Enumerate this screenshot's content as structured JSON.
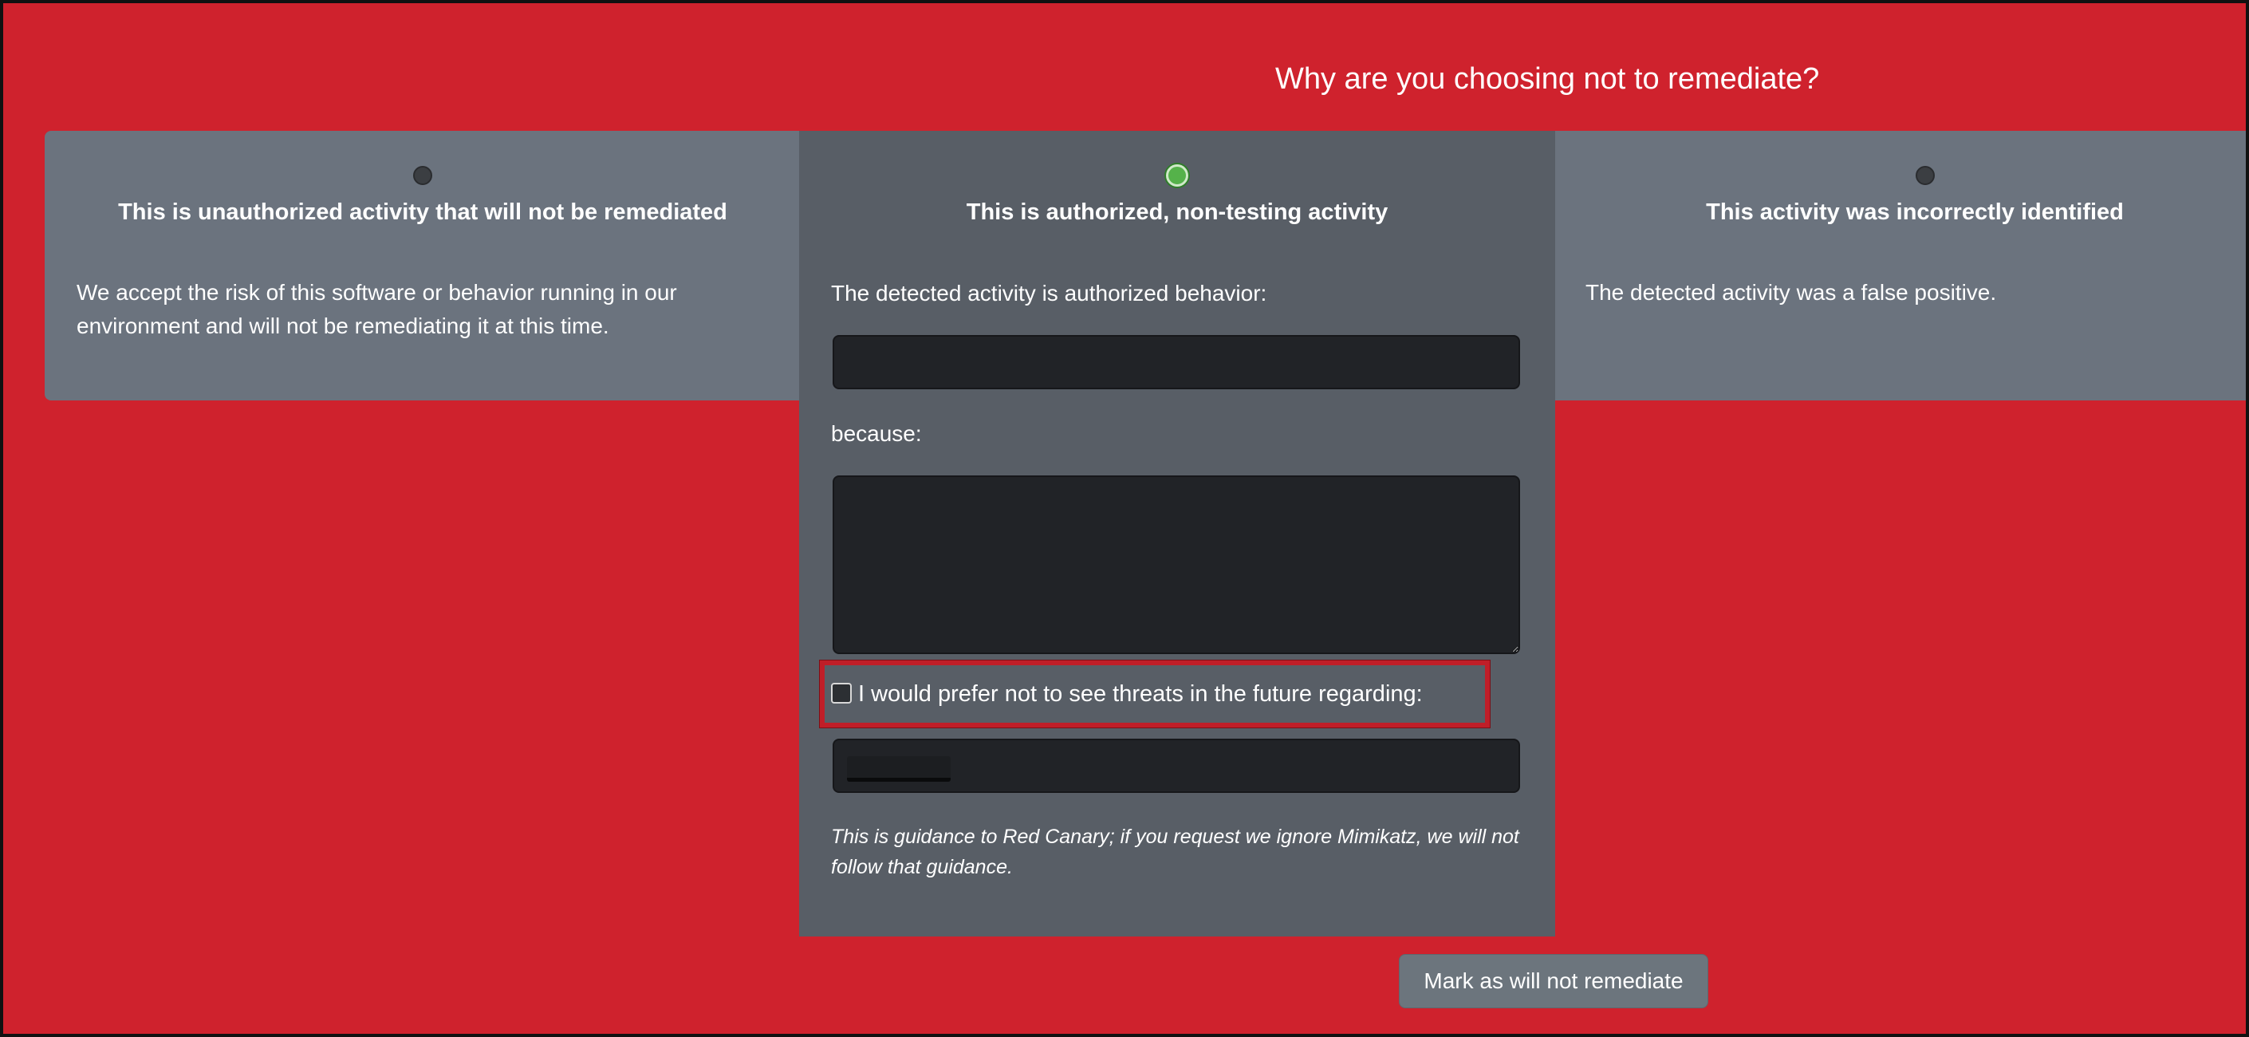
{
  "page": {
    "title": "Why are you choosing not to remediate?"
  },
  "options": [
    {
      "title": "This is unauthorized activity that will not be remediated",
      "description": "We accept the risk of this software or behavior running in our environment and will not be remediating it at this time.",
      "selected": false
    },
    {
      "title": "This is authorized, non-testing activity",
      "selected": true,
      "behavior_label": "The detected activity is authorized behavior:",
      "behavior_value": "",
      "because_label": "because:",
      "because_value": "",
      "future_checkbox_label": "I would prefer not to see threats in the future regarding:",
      "future_checkbox_checked": false,
      "guidance": "This is guidance to Red Canary; if you request we ignore Mimikatz, we will not follow that guidance."
    },
    {
      "title": "This activity was incorrectly identified",
      "description": "The detected activity was a false positive.",
      "selected": false
    }
  ],
  "actions": {
    "submit_label": "Mark as will not remediate"
  },
  "colors": {
    "page_background": "#cf222d",
    "card_background": "#6b737e",
    "selected_card_background": "#585e66",
    "input_background": "#212327",
    "selected_radio": "#55b24a",
    "button_background": "#6c757d",
    "highlight_border": "#c01e28"
  }
}
